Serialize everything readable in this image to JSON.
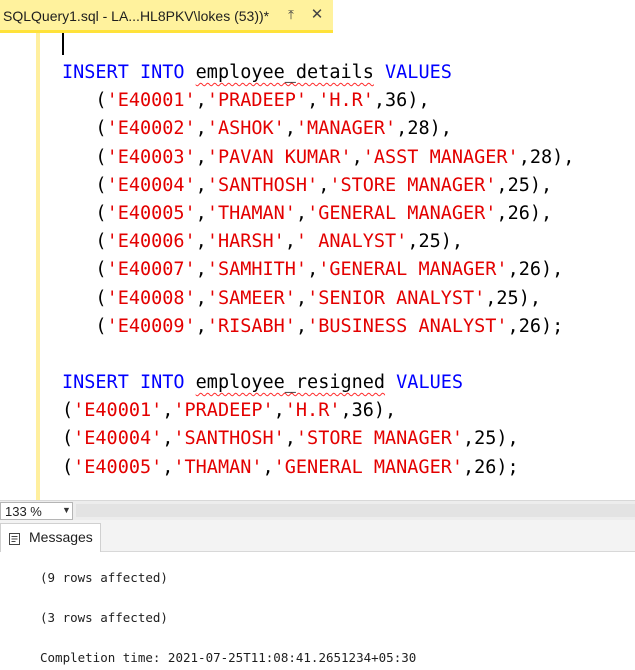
{
  "tab": {
    "title": "SQLQuery1.sql - LA...HL8PKV\\lokes (53))*",
    "pin_icon": "⤒",
    "close_icon": "✕"
  },
  "editor": {
    "line1": {
      "kw1": "INSERT",
      "kw2": "INTO",
      "table": "employee_details",
      "kw3": "VALUES"
    },
    "rows_details": [
      {
        "indent": "   ",
        "id": "'E40001'",
        "name": "'PRADEEP'",
        "role": "'H.R'",
        "age": "36",
        "end": "),"
      },
      {
        "indent": "   ",
        "id": "'E40002'",
        "name": "'ASHOK'",
        "role": "'MANAGER'",
        "age": "28",
        "end": "),"
      },
      {
        "indent": "   ",
        "id": "'E40003'",
        "name": "'PAVAN KUMAR'",
        "role": "'ASST MANAGER'",
        "age": "28",
        "end": "),"
      },
      {
        "indent": "   ",
        "id": "'E40004'",
        "name": "'SANTHOSH'",
        "role": "'STORE MANAGER'",
        "age": "25",
        "end": "),"
      },
      {
        "indent": "   ",
        "id": "'E40005'",
        "name": "'THAMAN'",
        "role": "'GENERAL MANAGER'",
        "age": "26",
        "end": "),"
      },
      {
        "indent": "   ",
        "id": "'E40006'",
        "name": "'HARSH'",
        "role": "' ANALYST'",
        "age": "25",
        "end": "),"
      },
      {
        "indent": "   ",
        "id": "'E40007'",
        "name": "'SAMHITH'",
        "role": "'GENERAL MANAGER'",
        "age": "26",
        "end": "),"
      },
      {
        "indent": "   ",
        "id": "'E40008'",
        "name": "'SAMEER'",
        "role": "'SENIOR ANALYST'",
        "age": "25",
        "end": "),"
      },
      {
        "indent": "   ",
        "id": "'E40009'",
        "name": "'RISABH'",
        "role": "'BUSINESS ANALYST'",
        "age": "26",
        "end": ");"
      }
    ],
    "line2": {
      "kw1": "INSERT",
      "kw2": "INTO",
      "table": "employee_resigned",
      "kw3": "VALUES"
    },
    "rows_resigned": [
      {
        "indent": "",
        "id": "'E40001'",
        "name": "'PRADEEP'",
        "role": "'H.R'",
        "age": "36",
        "end": "),"
      },
      {
        "indent": "",
        "id": "'E40004'",
        "name": "'SANTHOSH'",
        "role": "'STORE MANAGER'",
        "age": "25",
        "end": "),"
      },
      {
        "indent": "",
        "id": "'E40005'",
        "name": "'THAMAN'",
        "role": "'GENERAL MANAGER'",
        "age": "26",
        "end": ");"
      }
    ]
  },
  "zoom": {
    "value": "133 %",
    "arrow": "▼"
  },
  "results": {
    "messages_tab_label": "Messages"
  },
  "messages": {
    "line1": "(9 rows affected)",
    "line2": "(3 rows affected)",
    "line3": "Completion time: 2021-07-25T11:08:41.2651234+05:30"
  },
  "colors": {
    "keyword": "#0000ff",
    "string": "#e30000",
    "tab_active": "#fff29d",
    "tab_underline": "#ffe23a"
  }
}
